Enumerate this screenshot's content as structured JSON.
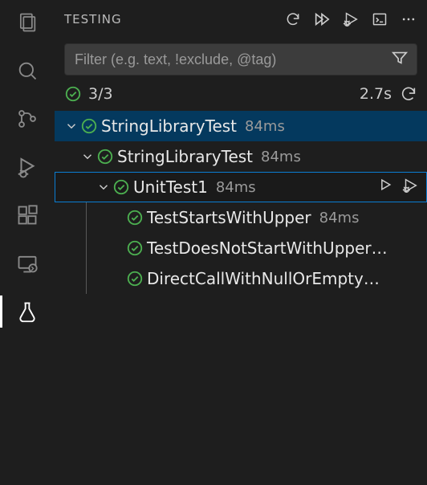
{
  "activitybar": {
    "items": [
      {
        "name": "explorer-icon"
      },
      {
        "name": "search-icon"
      },
      {
        "name": "source-control-icon"
      },
      {
        "name": "run-debug-icon"
      },
      {
        "name": "extensions-icon"
      },
      {
        "name": "remote-icon"
      },
      {
        "name": "testing-icon"
      }
    ],
    "active": "testing"
  },
  "panel": {
    "title": "TESTING",
    "actions": {
      "refresh": "refresh-icon",
      "run_all": "run-all-icon",
      "debug_all": "debug-run-icon",
      "output": "output-panel-icon",
      "more": "more-icon"
    },
    "filter": {
      "placeholder": "Filter (e.g. text, !exclude, @tag)",
      "value": ""
    },
    "summary": {
      "count_text": "3/3",
      "time_text": "2.7s"
    }
  },
  "tree": {
    "root": {
      "label": "StringLibraryTest",
      "duration": "84ms",
      "status": "pass",
      "expanded": true,
      "children": [
        {
          "label": "StringLibraryTest",
          "duration": "84ms",
          "status": "pass",
          "expanded": true,
          "children": [
            {
              "label": "UnitTest1",
              "duration": "84ms",
              "status": "pass",
              "expanded": true,
              "selected": true,
              "children": [
                {
                  "label": "TestStartsWithUpper",
                  "duration": "84ms",
                  "status": "pass"
                },
                {
                  "label": "TestDoesNotStartWithUpper…",
                  "duration": "",
                  "status": "pass"
                },
                {
                  "label": "DirectCallWithNullOrEmpty…",
                  "duration": "",
                  "status": "pass"
                }
              ]
            }
          ]
        }
      ]
    }
  },
  "icons": {
    "play": "play-icon",
    "debug": "debug-icon"
  }
}
